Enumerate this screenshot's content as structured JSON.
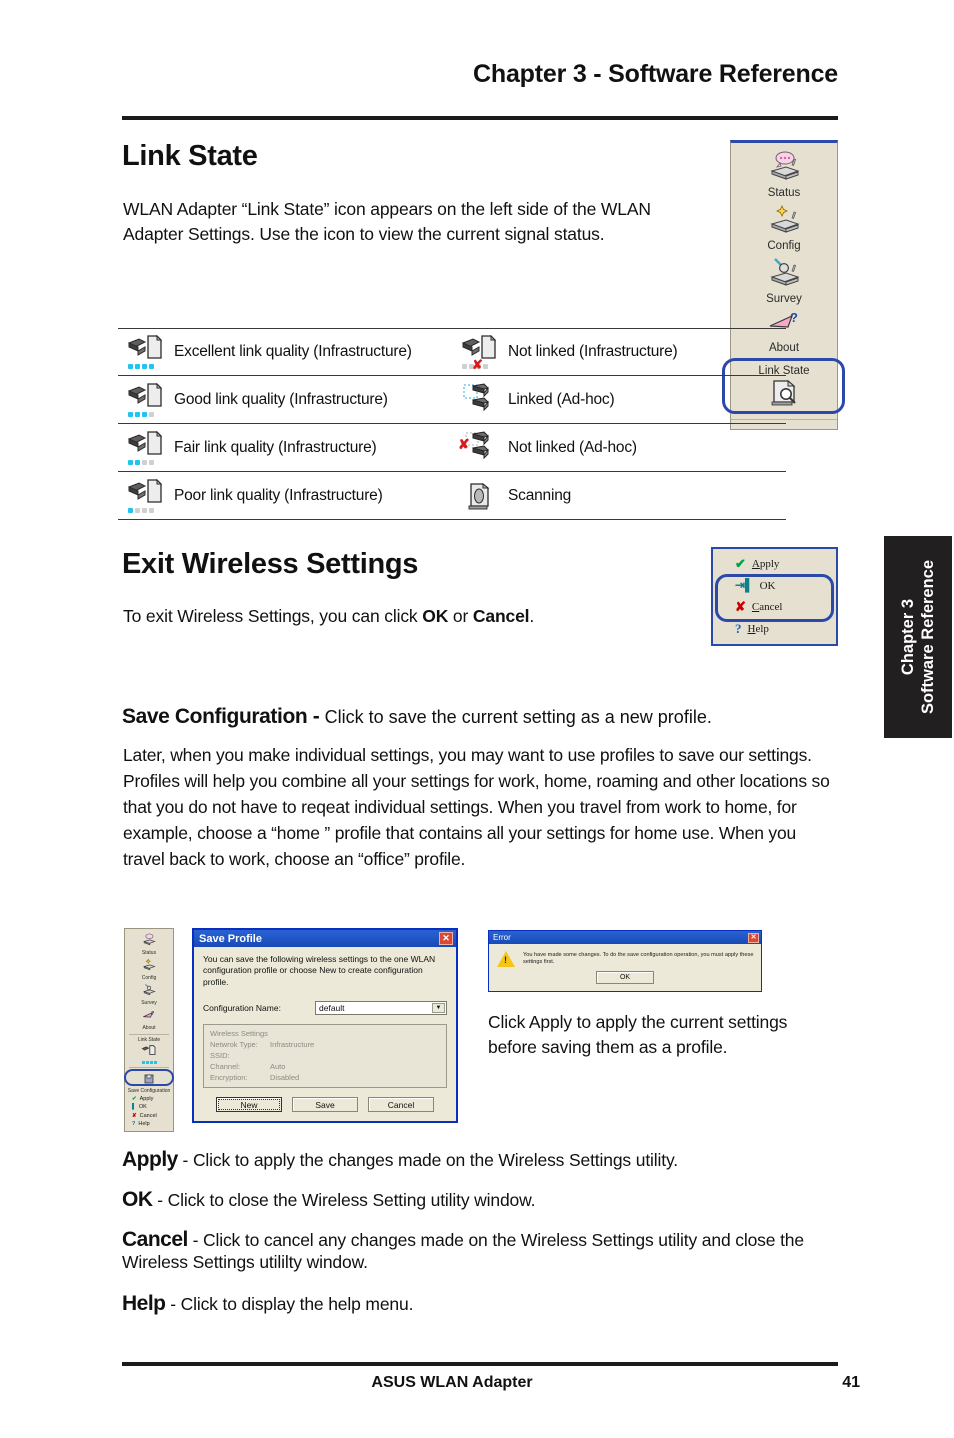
{
  "header": {
    "chapter_title": "Chapter 3 - Software Reference"
  },
  "side_tab": {
    "line1": "Chapter 3",
    "line2": "Software Reference"
  },
  "footer": {
    "product": "ASUS WLAN Adapter",
    "page_number": "41"
  },
  "link_state": {
    "heading": "Link State",
    "paragraph": "WLAN Adapter “Link State” icon appears on the left side of the WLAN Adapter Settings. Use the icon to view the current signal status.",
    "table": [
      {
        "left_label": "Excellent link quality (Infrastructure)",
        "left_icon": "infrastructure-signal-icon",
        "left_bars": 4,
        "right_label": "Not linked (Infrastructure)",
        "right_icon": "infrastructure-not-linked-icon"
      },
      {
        "left_label": "Good link quality (Infrastructure)",
        "left_icon": "infrastructure-signal-icon",
        "left_bars": 3,
        "right_label": "Linked (Ad-hoc)",
        "right_icon": "adhoc-linked-icon"
      },
      {
        "left_label": "Fair link quality (Infrastructure)",
        "left_icon": "infrastructure-signal-icon",
        "left_bars": 2,
        "right_label": "Not linked (Ad-hoc)",
        "right_icon": "adhoc-not-linked-icon"
      },
      {
        "left_label": "Poor link quality (Infrastructure)",
        "left_icon": "infrastructure-signal-icon",
        "left_bars": 1,
        "right_label": "Scanning",
        "right_icon": "scanning-icon"
      }
    ]
  },
  "util_panel": {
    "items": [
      {
        "label": "Status",
        "icon": "status-adapter-icon"
      },
      {
        "label": "Config",
        "icon": "config-adapter-icon"
      },
      {
        "label": "Survey",
        "icon": "survey-magnifier-icon"
      },
      {
        "label": "About",
        "icon": "about-arrow-question-icon"
      }
    ],
    "link_state_label": "Link State",
    "link_state_icon": "link-state-magnifier-icon"
  },
  "exit_section": {
    "heading": "Exit Wireless Settings",
    "paragraph_parts": [
      "To exit Wireless Settings, you can click ",
      "OK",
      " or ",
      "Cancel",
      "."
    ],
    "buttons": [
      {
        "label": "Apply",
        "accel": "A",
        "icon": "green-check-icon"
      },
      {
        "label": "OK",
        "accel": "O",
        "icon": "exit-door-icon"
      },
      {
        "label": "Cancel",
        "accel": "C",
        "icon": "red-x-icon"
      },
      {
        "label": "Help",
        "accel": "H",
        "icon": "question-mark-icon"
      }
    ]
  },
  "save_config": {
    "term": "Save Configuration -",
    "lead_desc": "Click to save the current setting as a new profile.",
    "paragraph": "Later, when you make individual settings, you may want to use profiles to save our settings. Profiles will help you combine all your settings for work, home, roaming and other locations so that you do not have to reqeat individual settings. When you travel from work to home, for example, choose a “home ” profile that contains all your settings for home use. When you travel back to work, choose an “office” profile."
  },
  "mini_panel": {
    "items": [
      {
        "label": "Status"
      },
      {
        "label": "Config"
      },
      {
        "label": "Survey"
      },
      {
        "label": "About"
      }
    ],
    "link_state_label": "Link State",
    "save_config_label": "Save Configuration",
    "buttons": [
      {
        "label": "Apply",
        "icon": "green-check-icon"
      },
      {
        "label": "OK",
        "icon": "exit-door-icon"
      },
      {
        "label": "Cancel",
        "icon": "red-x-icon"
      },
      {
        "label": "Help",
        "icon": "question-mark-icon"
      }
    ]
  },
  "save_profile_dialog": {
    "title": "Save Profile",
    "close_glyph": "✕",
    "description": "You can save the following wireless settings to the one WLAN configuration profile or choose New to create configuration profile.",
    "field_label": "Configuration Name:",
    "field_value": "default",
    "field_arrow": "▼",
    "settings_title": "Wireless Settings",
    "settings": [
      {
        "key": "Netwrok Type:",
        "value": "Infrastructure"
      },
      {
        "key": "SSID:",
        "value": ""
      },
      {
        "key": "Channel:",
        "value": "Auto"
      },
      {
        "key": "Encryption:",
        "value": "Disabled"
      }
    ],
    "buttons": [
      {
        "label": "New",
        "focused": true
      },
      {
        "label": "Save",
        "focused": false
      },
      {
        "label": "Cancel",
        "focused": false
      }
    ]
  },
  "error_dialog": {
    "title": "Error",
    "close_glyph": "✕",
    "icon": "warning-triangle-icon",
    "message": "You have made some changes. To do the save configuration operation, you must apply these settings first.",
    "ok_label": "OK"
  },
  "figure_caption": "Click Apply to apply the current settings before saving them as a profile.",
  "definitions": [
    {
      "term": "Apply",
      "desc": " - Click to apply the changes made on the Wireless Settings utility."
    },
    {
      "term": "OK",
      "desc": " - Click to close the Wireless Setting utility window."
    },
    {
      "term": "Cancel",
      "desc": " - Click to cancel any changes made on the Wireless Settings utility and close the Wireless Settings utililty window."
    },
    {
      "term": "Help",
      "desc": " - Click to display the help menu."
    }
  ],
  "colors": {
    "accent_blue": "#2a49a8",
    "signal_cyan": "#1fc4ef",
    "panel_bg": "#e5e0cf",
    "titlebar_blue": "#174ab5",
    "warning_red": "#d71920"
  }
}
